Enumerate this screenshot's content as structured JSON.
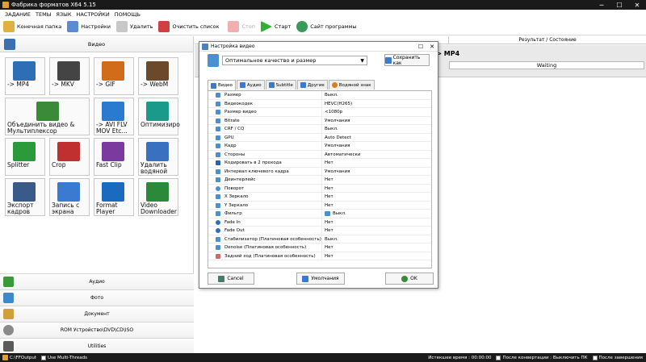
{
  "window": {
    "title": "Фабрика форматов X64 5.15",
    "minimize": "─",
    "maximize": "☐",
    "close": "✕"
  },
  "menu": [
    "ЗАДАНИЕ",
    "ТЕМЫ",
    "ЯЗЫК",
    "НАСТРОЙКИ",
    "ПОМОЩЬ"
  ],
  "toolbar": {
    "output_folder": "Конечная папка",
    "settings": "Настройки",
    "remove": "Удалить",
    "clear_list": "Очистить список",
    "stop": "Стоп",
    "start": "Старт",
    "website": "Сайт программы"
  },
  "left": {
    "video_header": "Видео",
    "tiles": [
      {
        "name": "mp4",
        "label": "-> MP4",
        "badge": "MP4",
        "color": "#2d6fb5"
      },
      {
        "name": "mkv",
        "label": "-> MKV",
        "badge": "MKV",
        "color": "#444444"
      },
      {
        "name": "gif",
        "label": "-> GIF",
        "badge": "GIF",
        "color": "#d06c1a"
      },
      {
        "name": "webm",
        "label": "-> WebM",
        "badge": "WebM",
        "color": "#6a4a2a"
      },
      {
        "name": "merge",
        "label": "Объединить видео &\nМультиплексор",
        "color": "#3a8a3a"
      },
      {
        "name": "avi-flv",
        "label": "-> AVI FLV\nMOV Etc...",
        "color": "#2a7ad0"
      },
      {
        "name": "optimize",
        "label": "Оптимизиро",
        "color": "#1a9a8a"
      },
      {
        "name": "splitter",
        "label": "Splitter",
        "color": "#2a9a3a"
      },
      {
        "name": "crop",
        "label": "Crop",
        "color": "#c03030"
      },
      {
        "name": "fast-clip",
        "label": "Fast Clip",
        "color": "#7a3aa0"
      },
      {
        "name": "remove-logo",
        "label": "Удалить\nводяной",
        "color": "#3a70c0"
      },
      {
        "name": "export-frames",
        "label": "Экспорт\nкадров",
        "color": "#3a5a8a"
      },
      {
        "name": "screen-record",
        "label": "Запись с\nэкрана",
        "color": "#3a7ad0"
      },
      {
        "name": "format-player",
        "label": "Format\nPlayer",
        "color": "#1a6ac0"
      },
      {
        "name": "video-downloader",
        "label": "Video\nDownloader",
        "color": "#2a8a3a"
      }
    ],
    "categories": [
      {
        "name": "audio",
        "label": "Аудио",
        "color": "#3a9a3a"
      },
      {
        "name": "photo",
        "label": "Фото",
        "color": "#3a8ad0"
      },
      {
        "name": "document",
        "label": "Документ",
        "color": "#d0a03a"
      },
      {
        "name": "rom",
        "label": "ROM Устройство\\DVD\\CD\\ISO",
        "color": "#8a8a8a"
      },
      {
        "name": "utilities",
        "label": "Utilities",
        "color": "#5a5a5a"
      }
    ]
  },
  "right": {
    "result_header": "Результат / Состояние",
    "row_target": "-> MP4",
    "row_status": "Waiting"
  },
  "dialog": {
    "title": "Настройка видео",
    "preset": "Оптимальное качество и размер",
    "save_as": "Сохранить как",
    "tabs": [
      {
        "name": "video",
        "label": "Видео",
        "color": "#3a7ad0"
      },
      {
        "name": "audio",
        "label": "Аудио",
        "color": "#3a7ad0"
      },
      {
        "name": "subtitle",
        "label": "Subtitle",
        "color": "#3a7ad0"
      },
      {
        "name": "other",
        "label": "Другие",
        "color": "#3a7ad0"
      },
      {
        "name": "watermark",
        "label": "Водяной знак",
        "color": "#e07a1a"
      }
    ],
    "properties": [
      {
        "name": "Размер",
        "value": "Выкл.",
        "color": "#4a90d0"
      },
      {
        "name": "Видеокодек",
        "value": "HEVC(H265)",
        "color": "#4a90d0"
      },
      {
        "name": "Размер видео",
        "value": "<1080p",
        "color": "#4a90d0"
      },
      {
        "name": "Bitrate",
        "value": "Умолчания",
        "color": "#4a90d0"
      },
      {
        "name": "CRF / CQ",
        "value": "Выкл.",
        "color": "#4a90d0"
      },
      {
        "name": "GPU",
        "value": "Auto Detect",
        "color": "#4a90d0"
      },
      {
        "name": "Кадр",
        "value": "Умолчания",
        "color": "#4a90d0"
      },
      {
        "name": "Стороны",
        "value": "Автоматически",
        "color": "#4a90d0"
      },
      {
        "name": "Кодировать в 2 прохода",
        "value": "Нет",
        "color": "#2a60b0"
      },
      {
        "name": "Интервал ключевого кадра",
        "value": "Умолчания",
        "color": "#4a90d0"
      },
      {
        "name": "Деинтерлейс",
        "value": "Нет",
        "color": "#4a90d0"
      },
      {
        "name": "Поворот",
        "value": "Нет",
        "color": "#4a90d0"
      },
      {
        "name": "X Зеркало",
        "value": "Нет",
        "color": "#4a90d0"
      },
      {
        "name": "Y Зеркало",
        "value": "Нет",
        "color": "#4a90d0"
      },
      {
        "name": "Фильтр",
        "value": "Выкл.",
        "color": "#4a90d0"
      },
      {
        "name": "Fade In",
        "value": "Нет",
        "color": "#2a70c0"
      },
      {
        "name": "Fade Out",
        "value": "Нет",
        "color": "#2a70c0"
      },
      {
        "name": "Стабилизатор (Платиновая особенность)",
        "value": "Выкл.",
        "color": "#4a90d0"
      },
      {
        "name": "Denoise (Платиновая особенность)",
        "value": "Нет",
        "color": "#4a90d0"
      },
      {
        "name": "Задний ход (Платиновая особенность)",
        "value": "Нет",
        "color": "#d06a6a"
      }
    ],
    "cancel": "Cancel",
    "defaults": "Умолчания",
    "ok": "OK"
  },
  "statusbar": {
    "output_path": "C:\\FFOutput",
    "multithread": "Use Multi-Threads",
    "elapsed": "Истекшее время : 00:00:00",
    "after_convert": "После конвертации : Выключить ПК",
    "after_done": "После завершения"
  }
}
